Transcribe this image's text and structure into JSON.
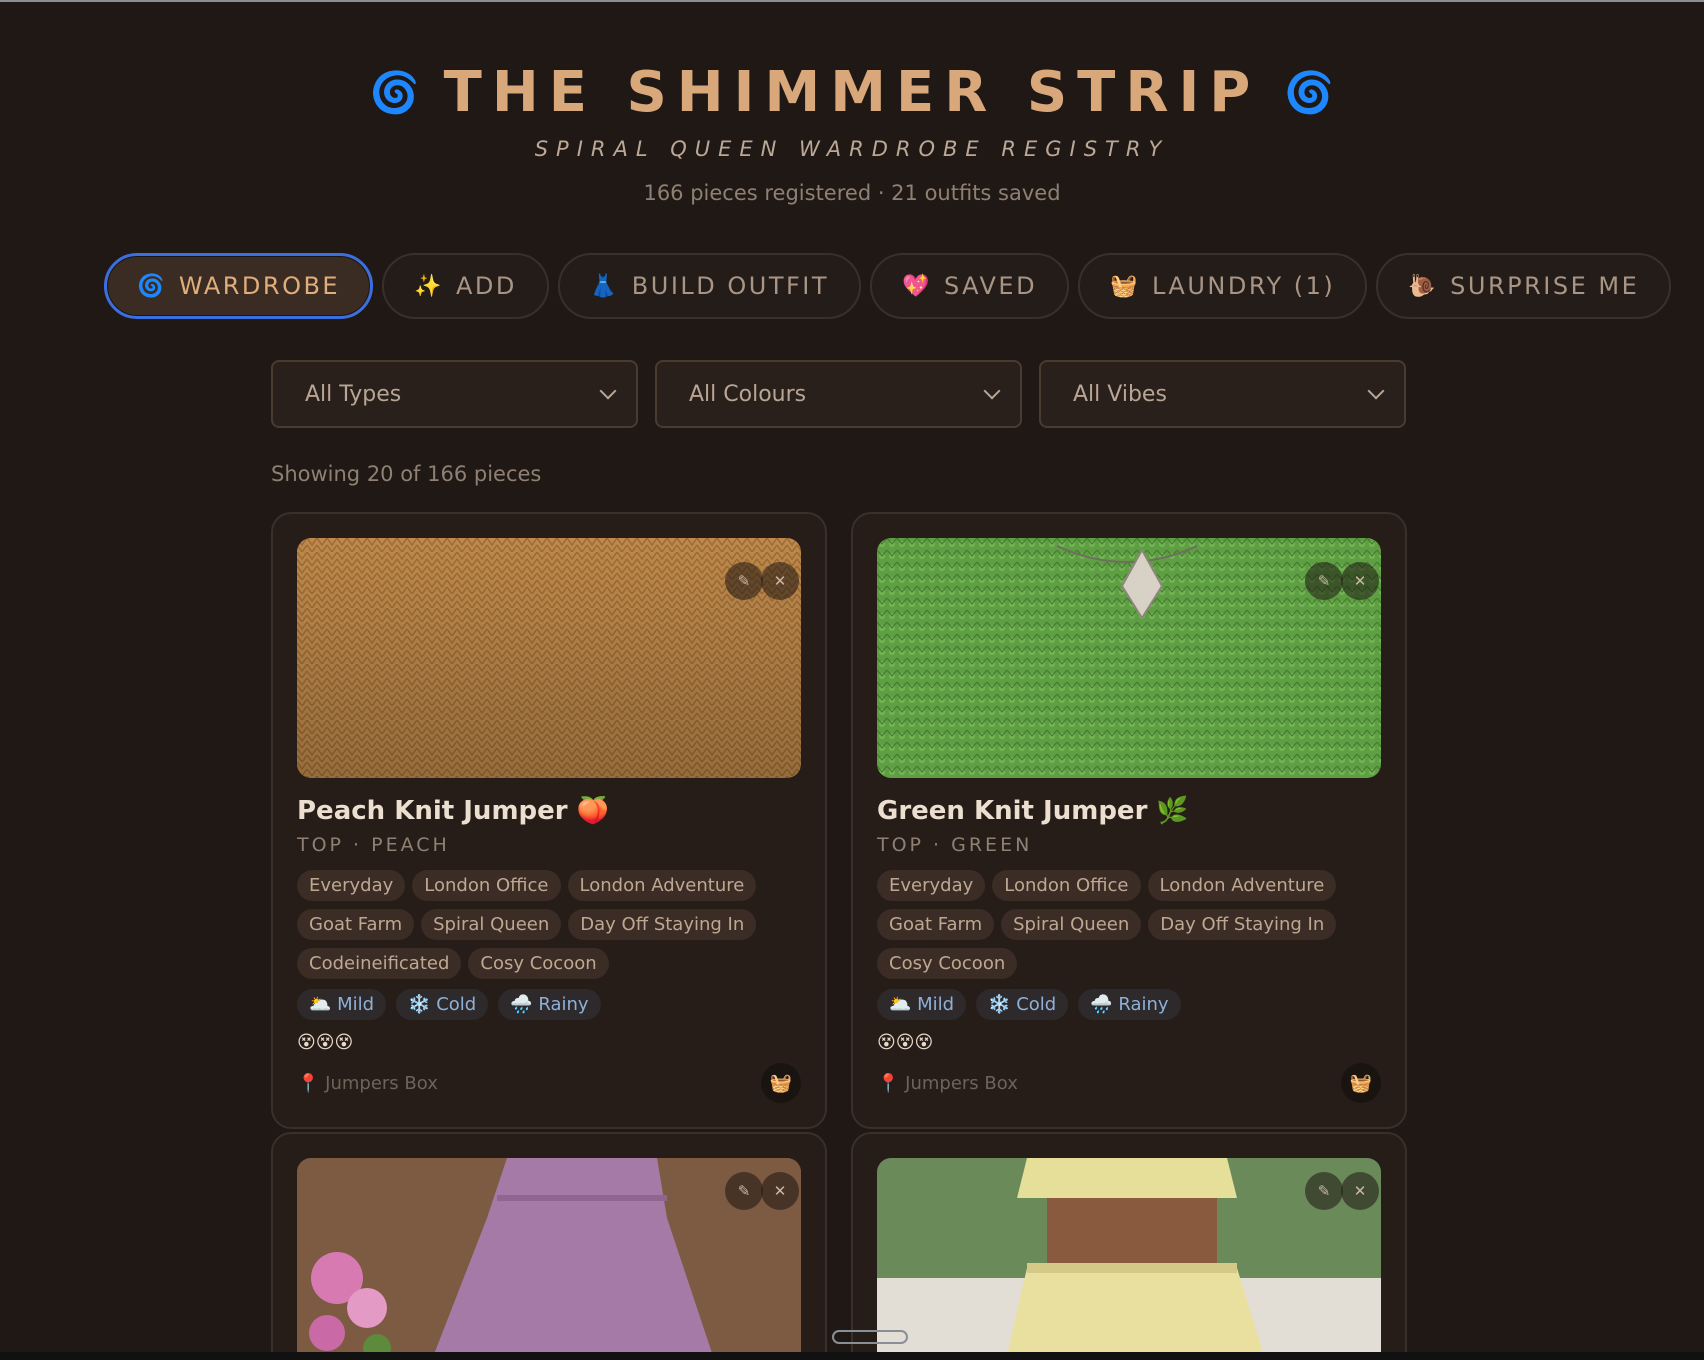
{
  "header": {
    "title": "THE SHIMMER STRIP",
    "subtitle": "SPIRAL QUEEN WARDROBE REGISTRY",
    "stats": "166 pieces registered · 21 outfits saved",
    "left_icon": "🌀",
    "right_icon": "🌀"
  },
  "tabs": [
    {
      "icon": "🌀",
      "label": "WARDROBE",
      "active": true
    },
    {
      "icon": "✨",
      "label": "ADD"
    },
    {
      "icon": "👗",
      "label": "BUILD OUTFIT"
    },
    {
      "icon": "💖",
      "label": "SAVED"
    },
    {
      "icon": "🧺",
      "label": "LAUNDRY (1)"
    },
    {
      "icon": "🐌",
      "label": "SURPRISE ME"
    }
  ],
  "filters": {
    "types": "All Types",
    "colours": "All Colours",
    "vibes": "All Vibes"
  },
  "showing": "Showing 20 of 166 pieces",
  "cards": [
    {
      "name": "Peach Knit Jumper 🍑",
      "meta": "TOP · PEACH",
      "tags": [
        "Everyday",
        "London Office",
        "London Adventure",
        "Goat Farm",
        "Spiral Queen",
        "Day Off Staying In",
        "Codeineificated",
        "Cosy Cocoon"
      ],
      "weather": [
        "🌥️ Mild",
        "❄️ Cold",
        "🌧️ Rainy"
      ],
      "rating": "😵😵😵",
      "location": "Jumpers Box",
      "photo_color": "#c28a4a"
    },
    {
      "name": "Green Knit Jumper 🌿",
      "meta": "TOP · GREEN",
      "tags": [
        "Everyday",
        "London Office",
        "London Adventure",
        "Goat Farm",
        "Spiral Queen",
        "Day Off Staying In",
        "Cosy Cocoon"
      ],
      "weather": [
        "🌥️ Mild",
        "❄️ Cold",
        "🌧️ Rainy"
      ],
      "rating": "😵😵😵",
      "location": "Jumpers Box",
      "photo_color": "#5a9a3e"
    },
    {
      "photo_color": "#a06f9e"
    },
    {
      "photo_color": "#d9cf8a"
    }
  ],
  "icons": {
    "edit": "✎",
    "close": "✕",
    "pin": "📍",
    "laundry": "🧺"
  }
}
